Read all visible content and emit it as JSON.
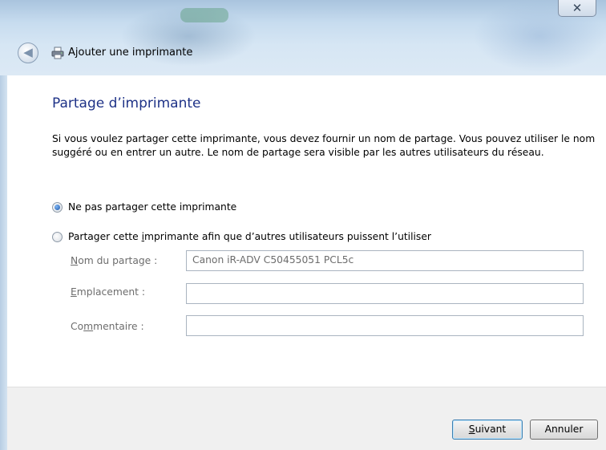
{
  "window": {
    "title": "Ajouter une imprimante",
    "close_symbol": "✕"
  },
  "icons": {
    "back": "back-arrow-icon",
    "printer": "printer-icon",
    "close": "close-icon"
  },
  "page": {
    "heading": "Partage d’imprimante",
    "description": "Si vous voulez partager cette imprimante, vous devez fournir un nom de partage. Vous pouvez utiliser le nom suggéré ou en entrer un autre. Le nom de partage sera visible par les autres utilisateurs du réseau."
  },
  "options": {
    "no_share": {
      "label": "Ne pas partager cette imprimante",
      "selected": true
    },
    "share": {
      "label_prefix": "Partager cette ",
      "label_accel": "i",
      "label_suffix": "mprimante afin que d’autres utilisateurs puissent l’utiliser",
      "selected": false
    }
  },
  "fields": {
    "share_name": {
      "label_accel": "N",
      "label_rest": "om du partage :",
      "value": "Canon iR-ADV C50455051 PCL5c"
    },
    "location": {
      "label_accel": "E",
      "label_rest": "mplacement :",
      "value": ""
    },
    "comment": {
      "label_prefix": "Co",
      "label_accel": "m",
      "label_rest": "mentaire :",
      "value": ""
    }
  },
  "buttons": {
    "next_accel": "S",
    "next_rest": "uivant",
    "cancel": "Annuler"
  },
  "colors": {
    "heading": "#1e3287",
    "accent": "#3c7fb1"
  }
}
